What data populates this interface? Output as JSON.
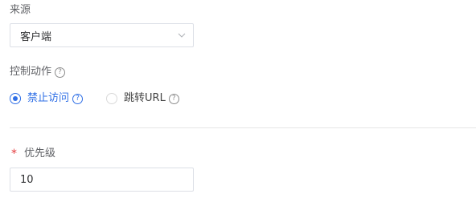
{
  "source": {
    "label": "来源",
    "selected_value": "客户端"
  },
  "control_action": {
    "label": "控制动作",
    "help_glyph": "?",
    "options": [
      {
        "label": "禁止访问",
        "checked": true
      },
      {
        "label": "跳转URL",
        "checked": false
      }
    ]
  },
  "priority": {
    "required_mark": "*",
    "label": "优先级",
    "value": "10"
  },
  "colors": {
    "accent": "#2f6fe6",
    "required": "#e4393c",
    "border": "#dcdfe6",
    "label": "#606266"
  },
  "icons": {
    "help": "question-circle-icon",
    "dropdown": "chevron-down-icon",
    "radio": "radio-icon"
  }
}
